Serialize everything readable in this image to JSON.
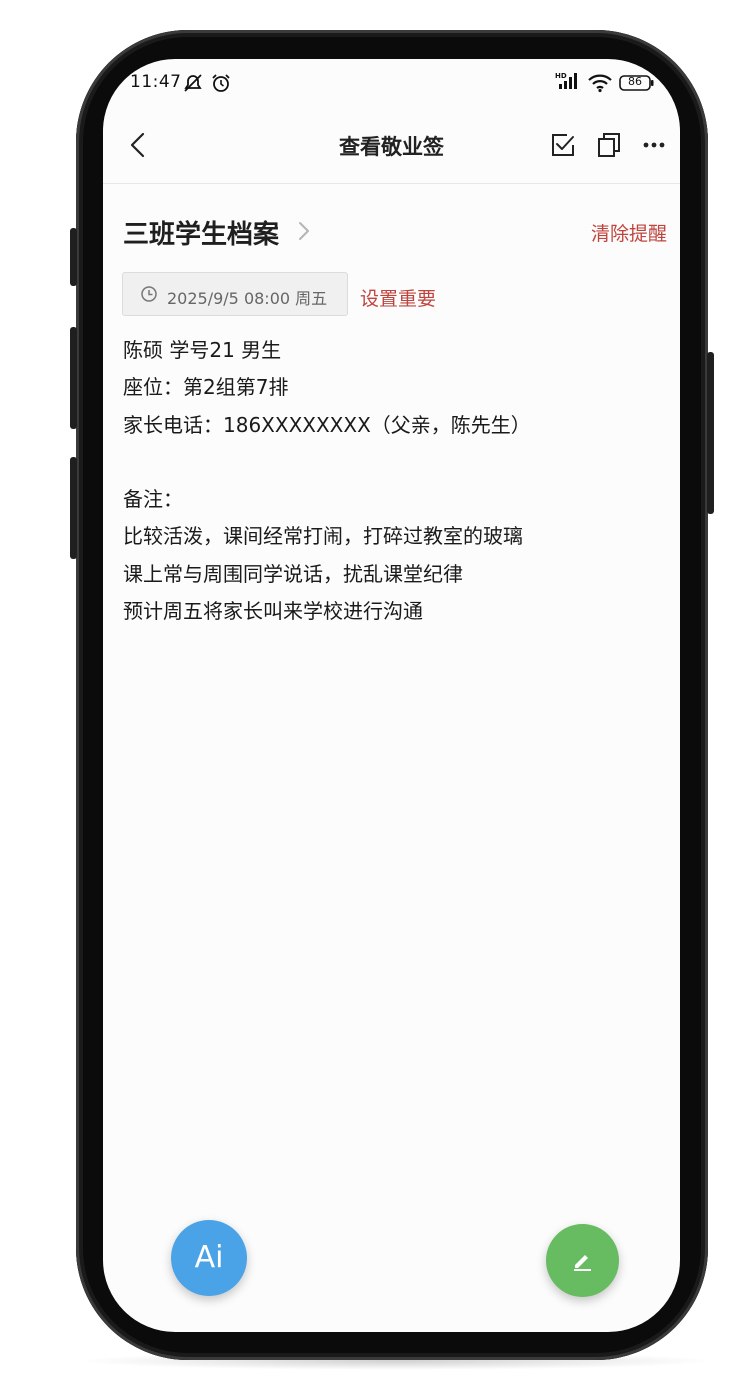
{
  "status_bar": {
    "time": "11:47",
    "battery": "86",
    "icons": [
      "mute-icon",
      "alarm-icon",
      "hd-signal-icon",
      "wifi-icon",
      "battery-icon"
    ]
  },
  "header": {
    "title": "查看敬业签",
    "icons": [
      "back-icon",
      "checkbox-icon",
      "copy-icon",
      "more-icon"
    ]
  },
  "note": {
    "title": "三班学生档案",
    "clear_reminder": "清除提醒",
    "reminder_time": "2025/9/5 08:00 周五",
    "set_important": "设置重要",
    "lines": [
      "陈硕 学号21 男生",
      "座位：第2组第7排",
      "家长电话：186XXXXXXXX（父亲，陈先生）",
      "",
      "备注：",
      "比较活泼，课间经常打闹，打碎过教室的玻璃",
      "课上常与周围同学说话，扰乱课堂纪律",
      "预计周五将家长叫来学校进行沟通"
    ]
  },
  "fab": {
    "ai_label": "Ai",
    "edit_icon": "edit-icon"
  },
  "colors": {
    "accent_red": "#c0443e",
    "ai_blue": "#4aa3e6",
    "edit_green": "#67bb61"
  }
}
